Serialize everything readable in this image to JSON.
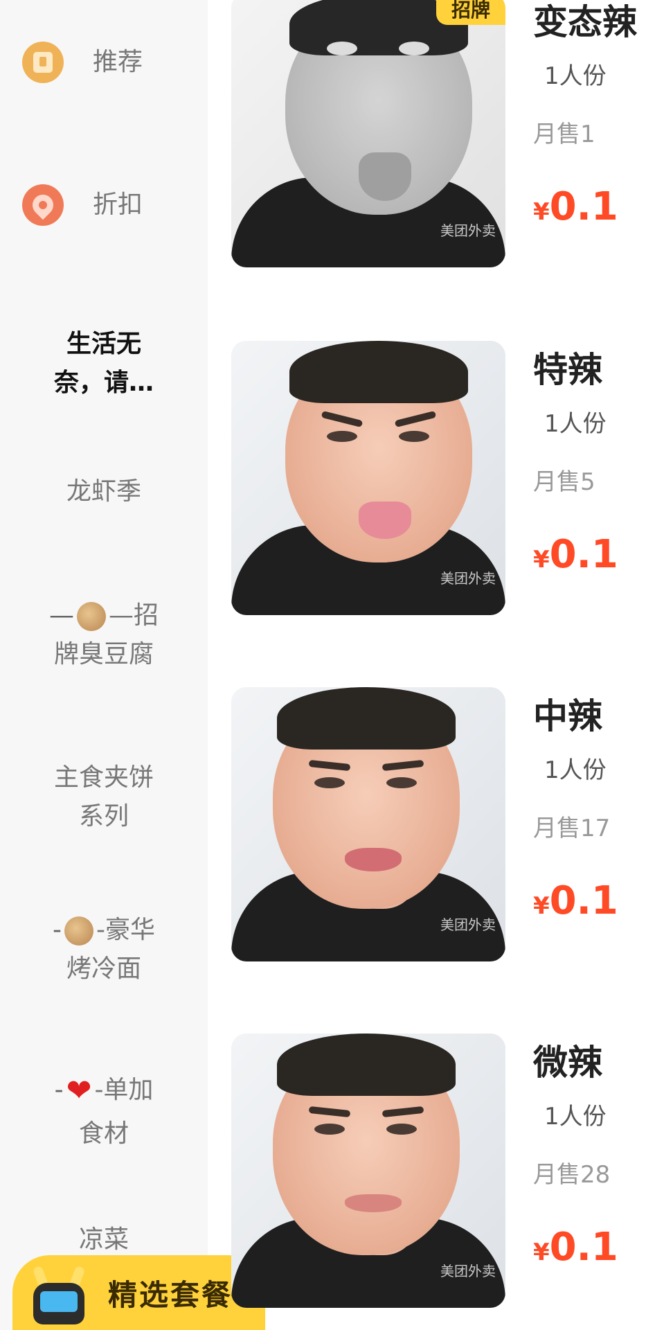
{
  "sidebar": {
    "categories": [
      {
        "label": "推荐",
        "icon": "recommend-icon"
      },
      {
        "label": "折扣",
        "icon": "discount-tag-icon"
      },
      {
        "label_line1": "生活无",
        "label_line2": "奈，请…"
      },
      {
        "label": "龙虾季"
      },
      {
        "prefix": "—",
        "suffix": "—招",
        "label_line2": "牌臭豆腐",
        "icon": "food-emoji-icon"
      },
      {
        "label_line1": "主食夹饼",
        "label_line2": "系列"
      },
      {
        "prefix": "-",
        "suffix": "-豪华",
        "label_line2": "烤冷面",
        "icon": "food-emoji-icon"
      },
      {
        "prefix": "-",
        "suffix": "-单加",
        "label_line2": "食材",
        "icon": "heart-icon"
      },
      {
        "label": "凉菜"
      }
    ],
    "combo": {
      "label": "精选套餐",
      "icon": "mascot-icon"
    }
  },
  "products": [
    {
      "name": "变态辣",
      "tag": "招牌",
      "portion": "1人份",
      "sales": "月售1",
      "currency": "¥",
      "price": "0.1",
      "watermark": "美团外卖"
    },
    {
      "name": "特辣",
      "portion": "1人份",
      "sales": "月售5",
      "currency": "¥",
      "price": "0.1",
      "watermark": "美团外卖"
    },
    {
      "name": "中辣",
      "portion": "1人份",
      "sales": "月售17",
      "currency": "¥",
      "price": "0.1",
      "watermark": "美团外卖"
    },
    {
      "name": "微辣",
      "portion": "1人份",
      "sales": "月售28",
      "currency": "¥",
      "price": "0.1",
      "watermark": "美团外卖"
    }
  ],
  "colors": {
    "accent_yellow": "#ffd23c",
    "price_red": "#ff4a26",
    "sidebar_bg": "#f7f7f7"
  }
}
